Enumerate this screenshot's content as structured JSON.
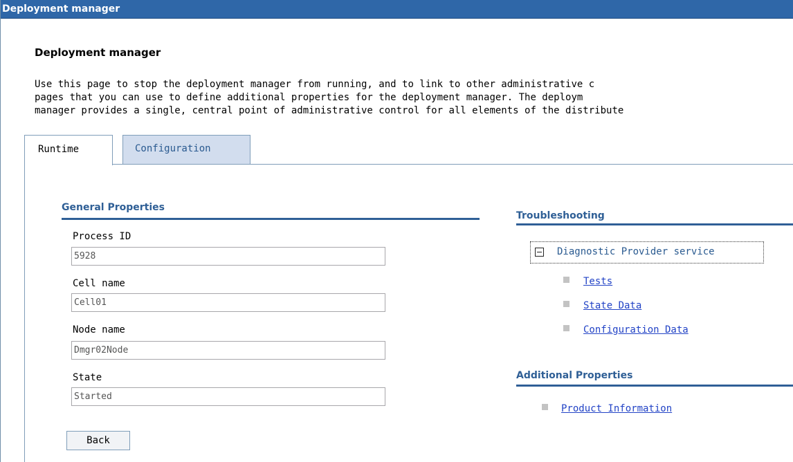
{
  "window": {
    "title": "Deployment manager"
  },
  "page": {
    "heading": "Deployment manager",
    "description": [
      "Use this page to stop the deployment manager from running, and to link to other administrative c",
      "pages that you can use to define additional properties for the deployment manager. The deploym",
      "manager provides a single, central point of administrative control for all elements of the distribute"
    ]
  },
  "tabs": {
    "runtime": "Runtime",
    "configuration": "Configuration"
  },
  "general": {
    "title": "General Properties",
    "process_id": {
      "label": "Process ID",
      "value": "5928"
    },
    "cell_name": {
      "label": "Cell name",
      "value": "Cell01"
    },
    "node_name": {
      "label": "Node name",
      "value": "Dmgr02Node"
    },
    "state": {
      "label": "State",
      "value": "Started"
    },
    "back_label": "Back"
  },
  "troubleshooting": {
    "title": "Troubleshooting",
    "diagnostic_provider": "Diagnostic Provider service",
    "links": [
      "Tests",
      "State Data",
      "Configuration Data"
    ]
  },
  "additional": {
    "title": "Additional Properties",
    "links": [
      "Product Information"
    ]
  },
  "colors": {
    "titlebar": "#2f67a8",
    "section_heading": "#2f5f96",
    "link": "#2243c6",
    "inactive_tab": "#d2ddee"
  }
}
